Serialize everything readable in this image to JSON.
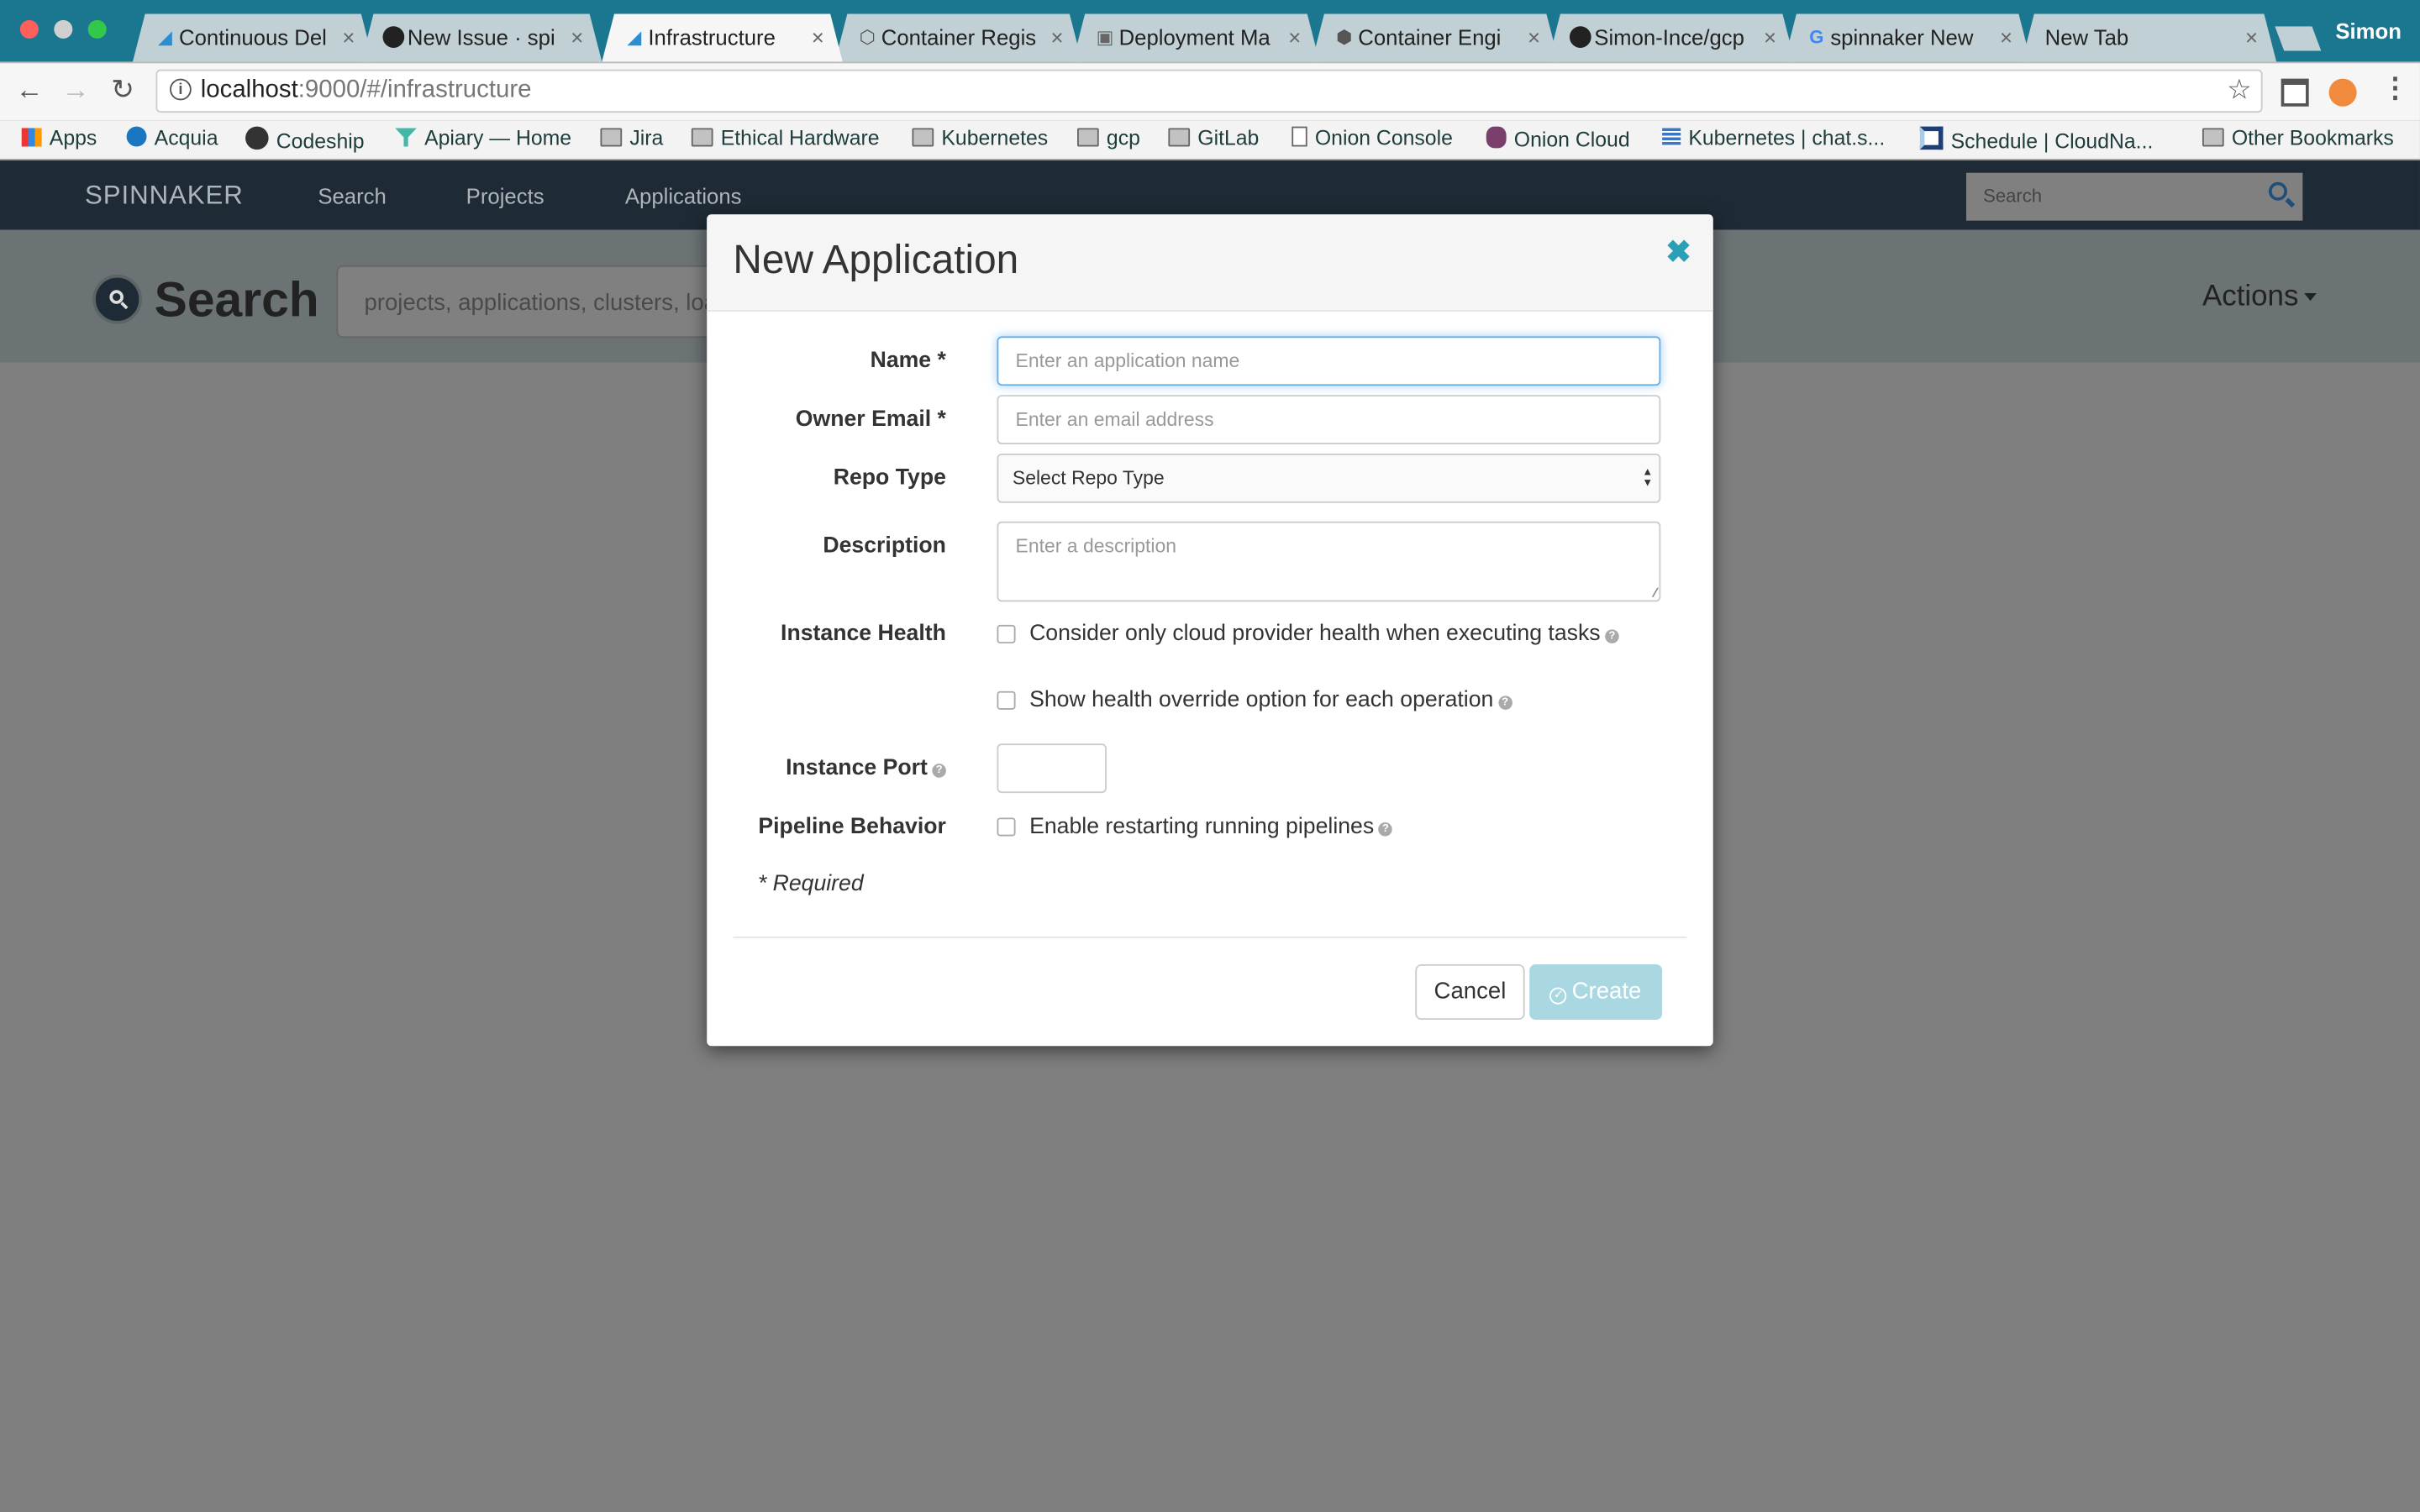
{
  "browser": {
    "tabs": [
      {
        "title": "Continuous Del",
        "icon": "spinnaker-icon"
      },
      {
        "title": "New Issue · spi",
        "icon": "github-icon"
      },
      {
        "title": "Infrastructure",
        "icon": "spinnaker-icon",
        "active": true
      },
      {
        "title": "Container Regis",
        "icon": "container-registry-icon"
      },
      {
        "title": "Deployment Ma",
        "icon": "deployment-manager-icon"
      },
      {
        "title": "Container Engi",
        "icon": "container-engine-icon"
      },
      {
        "title": "Simon-Ince/gcp",
        "icon": "github-icon"
      },
      {
        "title": "spinnaker New",
        "icon": "google-icon"
      },
      {
        "title": "New Tab",
        "icon": ""
      }
    ],
    "profile_name": "Simon",
    "url_host": "localhost",
    "url_rest": ":9000/#/infrastructure",
    "bookmarks": [
      {
        "label": "Apps",
        "icon": "apps-grid-icon"
      },
      {
        "label": "Acquia",
        "icon": "acquia-drop-icon"
      },
      {
        "label": "Codeship",
        "icon": "codeship-icon"
      },
      {
        "label": "Apiary — Home",
        "icon": "apiary-icon"
      },
      {
        "label": "Jira",
        "icon": "folder-icon"
      },
      {
        "label": "Ethical Hardware",
        "icon": "folder-icon"
      },
      {
        "label": "Kubernetes",
        "icon": "folder-icon"
      },
      {
        "label": "gcp",
        "icon": "folder-icon"
      },
      {
        "label": "GitLab",
        "icon": "folder-icon"
      },
      {
        "label": "Onion Console",
        "icon": "page-icon"
      },
      {
        "label": "Onion Cloud",
        "icon": "onion-icon"
      },
      {
        "label": "Kubernetes | chat.s...",
        "icon": "stack-icon"
      },
      {
        "label": "Schedule | CloudNa...",
        "icon": "schedule-icon"
      },
      {
        "label": "Other Bookmarks",
        "icon": "folder-icon"
      }
    ]
  },
  "app": {
    "brand": "SPINNAKER",
    "nav": [
      "Search",
      "Projects",
      "Applications"
    ],
    "nav_search_placeholder": "Search",
    "hero_title": "Search",
    "hero_search_placeholder": "projects, applications, clusters, load balancers, server groups, instances, security groups",
    "actions_label": "Actions"
  },
  "modal": {
    "title": "New Application",
    "fields": {
      "name": {
        "label": "Name *",
        "placeholder": "Enter an application name",
        "value": ""
      },
      "owner_email": {
        "label": "Owner Email *",
        "placeholder": "Enter an email address",
        "value": ""
      },
      "repo_type": {
        "label": "Repo Type",
        "selected": "Select Repo Type"
      },
      "description": {
        "label": "Description",
        "placeholder": "Enter a description",
        "value": ""
      },
      "instance_health": {
        "label": "Instance Health",
        "options": [
          {
            "label": "Consider only cloud provider health when executing tasks",
            "checked": false
          },
          {
            "label": "Show health override option for each operation",
            "checked": false
          }
        ]
      },
      "instance_port": {
        "label": "Instance Port",
        "value": ""
      },
      "pipeline_behavior": {
        "label": "Pipeline Behavior",
        "options": [
          {
            "label": "Enable restarting running pipelines",
            "checked": false
          }
        ]
      }
    },
    "required_note": "* Required",
    "cancel_label": "Cancel",
    "create_label": "Create"
  },
  "colors": {
    "tabbar": "#1b7690",
    "app_nav": "#1e2a36",
    "accent": "#2aa0b8",
    "create_disabled": "#a9d8e2"
  }
}
